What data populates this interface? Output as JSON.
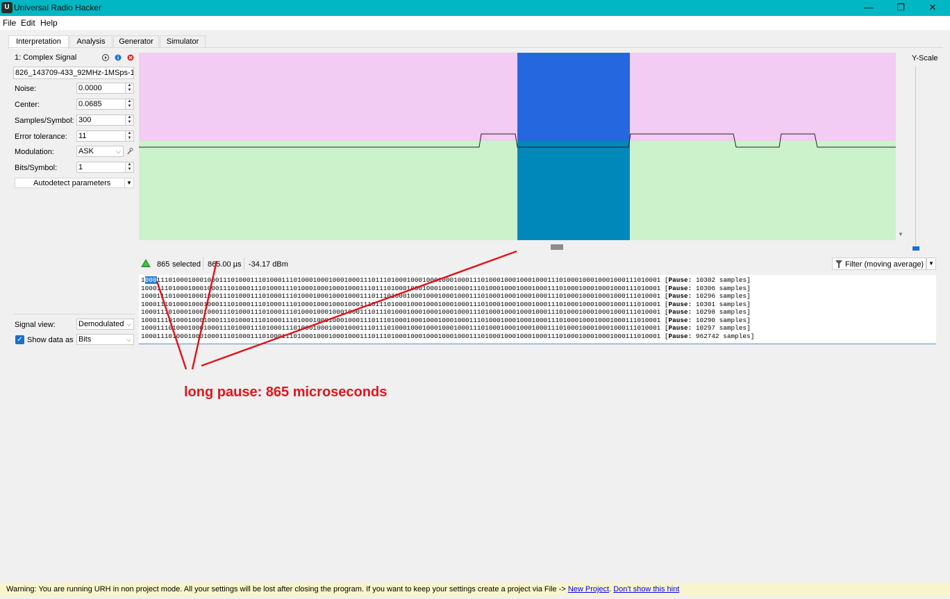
{
  "window": {
    "title": "Universal Radio Hacker",
    "minimize": "—",
    "maximize": "❐",
    "close": "✕",
    "icon_text": "U"
  },
  "menu": [
    "File",
    "Edit",
    "Help"
  ],
  "tabs": [
    "Interpretation",
    "Analysis",
    "Generator",
    "Simulator"
  ],
  "signal": {
    "header": "1:  Complex Signal",
    "filename": "826_143709-433_92MHz-1MSps-1MHz",
    "noise_label": "Noise:",
    "noise": "0.0000",
    "center_label": "Center:",
    "center": "0.0685",
    "sps_label": "Samples/Symbol:",
    "sps": "300",
    "tol_label": "Error tolerance:",
    "tol": "11",
    "mod_label": "Modulation:",
    "mod": "ASK",
    "bps_label": "Bits/Symbol:",
    "bps": "1",
    "autodetect": "Autodetect parameters",
    "view_label": "Signal view:",
    "view": "Demodulated",
    "show_label": "Show data as",
    "show": "Bits"
  },
  "yscale": "Y-Scale",
  "status": {
    "selected_count": "865",
    "selected_label": "selected",
    "duration": "865.00 µs",
    "power": "-34.17 dBm",
    "filter": "Filter (moving average)"
  },
  "bits": [
    {
      "pre": "1",
      "sel": "000",
      "rest": "111010001000100011101000111010001110100010001000100011101110100010001000100010001110100010001000100011101000100010001000111010001",
      "pause_label": "Pause:",
      "pause": "10302 samples"
    },
    {
      "pre": "",
      "sel": "",
      "rest": "1000111010001000100011101000111010001110100010001000100011101110100010001000100010001110100010001000100011101000100010001000111010001",
      "pause_label": "Pause:",
      "pause": "10306 samples"
    },
    {
      "pre": "",
      "sel": "",
      "rest": "1000111010001000100011101000111010001110100010001000100011101110100010001000100010001110100010001000100011101000100010001000111010001",
      "pause_label": "Pause:",
      "pause": "10296 samples"
    },
    {
      "pre": "",
      "sel": "",
      "rest": "1000111010001000100011101000111010001110100010001000100011101110100010001000100010001110100010001000100011101000100010001000111010001",
      "pause_label": "Pause:",
      "pause": "10301 samples"
    },
    {
      "pre": "",
      "sel": "",
      "rest": "1000111010001000100011101000111010001110100010001000100011101110100010001000100010001110100010001000100011101000100010001000111010001",
      "pause_label": "Pause:",
      "pause": "10298 samples"
    },
    {
      "pre": "",
      "sel": "",
      "rest": "1000111010001000100011101000111010001110100010001000100011101110100010001000100010001110100010001000100011101000100010001000111010001",
      "pause_label": "Pause:",
      "pause": "10290 samples"
    },
    {
      "pre": "",
      "sel": "",
      "rest": "1000111010001000100011101000111010001110100010001000100011101110100010001000100010001110100010001000100011101000100010001000111010001",
      "pause_label": "Pause:",
      "pause": "10297 samples"
    },
    {
      "pre": "",
      "sel": "",
      "rest": "1000111010001000100011101000111010001110100010001000100011101110100010001000100010001110100010001000100011101000100010001000111010001",
      "pause_label": "Pause:",
      "pause": "962742 samples"
    }
  ],
  "annotation": "long pause: 865 microseconds",
  "warning": {
    "text": "Warning: You are running URH in non project mode. All your settings will be lost after closing the program. If you want to keep your settings create a project via File -> ",
    "link1": "New Project",
    "sep": ". ",
    "link2": "Don't show this hint"
  },
  "colors": {
    "titlebar": "#00b7c3",
    "noise_area": "#f2ccf2",
    "signal_area": "#ccf2cc",
    "selection_top": "#2567de",
    "selection_bottom": "#0088bb",
    "annotation": "#e0161d"
  }
}
